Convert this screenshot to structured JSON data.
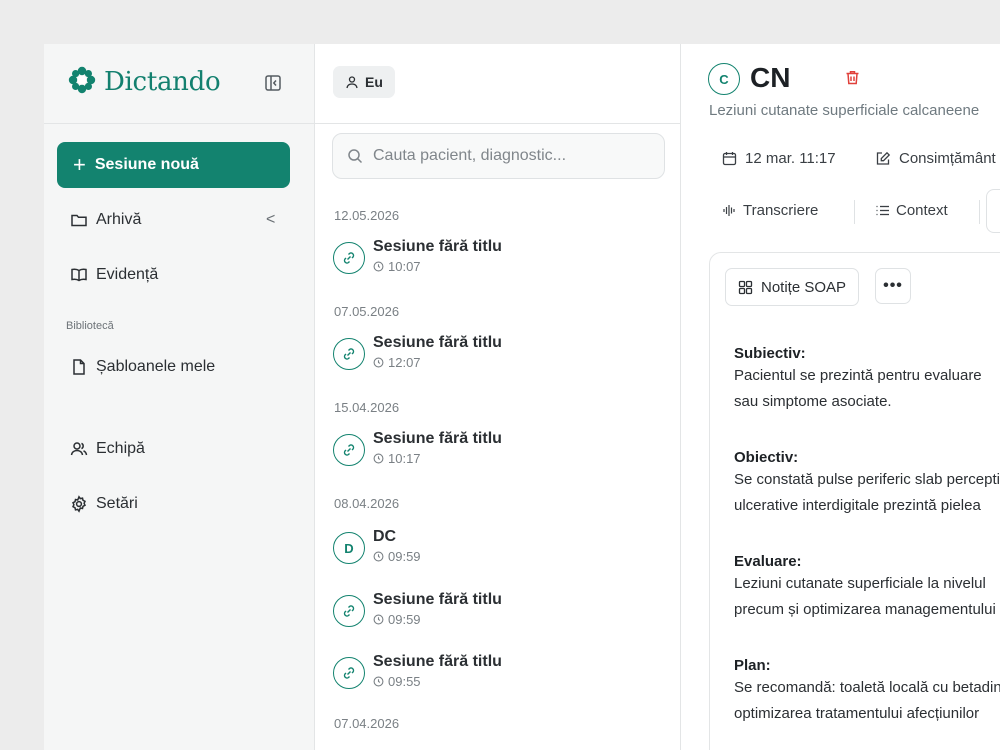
{
  "sidebar": {
    "brand": "Dictando",
    "new_session": "Sesiune nouă",
    "nav": [
      {
        "label": "Arhivă",
        "icon": "folder-icon"
      },
      {
        "label": "Evidență",
        "icon": "book-icon"
      }
    ],
    "section_label": "Bibliotecă",
    "library": [
      {
        "label": "Șabloanele mele",
        "icon": "file-icon"
      }
    ],
    "bottom": [
      {
        "label": "Echipă",
        "icon": "users-icon"
      },
      {
        "label": "Setări",
        "icon": "gear-icon"
      }
    ]
  },
  "middle": {
    "filter_chip": "Eu",
    "search_placeholder": "Cauta pacient, diagnostic...",
    "groups": [
      {
        "date": "12.05.2026",
        "sessions": [
          {
            "title": "Sesiune fără titlu",
            "time": "10:07",
            "icon": "link-icon"
          }
        ]
      },
      {
        "date": "07.05.2026",
        "sessions": [
          {
            "title": "Sesiune fără titlu",
            "time": "12:07",
            "icon": "link-icon"
          }
        ]
      },
      {
        "date": "15.04.2026",
        "sessions": [
          {
            "title": "Sesiune fără titlu",
            "time": "10:17",
            "icon": "link-icon"
          }
        ]
      },
      {
        "date": "08.04.2026",
        "sessions": [
          {
            "title": "DC",
            "time": "09:59",
            "initial": "D"
          },
          {
            "title": "Sesiune fără titlu",
            "time": "09:59",
            "icon": "link-icon"
          },
          {
            "title": "Sesiune fără titlu",
            "time": "09:55",
            "icon": "link-icon"
          }
        ]
      },
      {
        "date": "07.04.2026",
        "sessions": []
      }
    ]
  },
  "detail": {
    "avatar_initial": "C",
    "patient": "CN",
    "diagnosis": "Leziuni cutanate superficiale calcaneene",
    "date": "12 mar. 11:17",
    "consent": "Consimțământ",
    "tabs": [
      "Transcriere",
      "Context"
    ],
    "notes_button": "Notițe SOAP",
    "more_button": "•••",
    "soap": [
      {
        "heading": "Subiectiv:",
        "lines": [
          "Pacientul se prezintă pentru evaluare",
          "sau simptome asociate."
        ]
      },
      {
        "heading": "Obiectiv:",
        "lines": [
          "Se constată pulse periferic slab perceptibile",
          "ulcerative interdigitale prezintă pielea"
        ]
      },
      {
        "heading": "Evaluare:",
        "lines": [
          "Leziuni cutanate superficiale la nivelul",
          "precum și optimizarea managementului"
        ]
      },
      {
        "heading": "Plan:",
        "lines": [
          "Se recomandă: toaletă locală cu betadină",
          "optimizarea tratamentului afecțiunilor"
        ]
      }
    ]
  },
  "colors": {
    "accent": "#13836f",
    "sidebar_bg": "#f5f6f6",
    "page_bg": "#ececec",
    "danger": "#e0403a"
  }
}
